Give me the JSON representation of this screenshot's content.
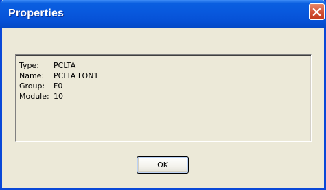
{
  "window": {
    "title": "Properties"
  },
  "properties": [
    {
      "label": "Type:",
      "value": "PCLTA"
    },
    {
      "label": "Name:",
      "value": "PCLTA LON1"
    },
    {
      "label": "Group:",
      "value": "F0"
    },
    {
      "label": "Module:",
      "value": "10"
    }
  ],
  "buttons": {
    "ok_label": "OK"
  },
  "icons": {
    "close": "close-icon"
  },
  "colors": {
    "titlebar": "#0a5fe0",
    "close_button": "#d3543a",
    "dialog_background": "#ece9d8"
  }
}
